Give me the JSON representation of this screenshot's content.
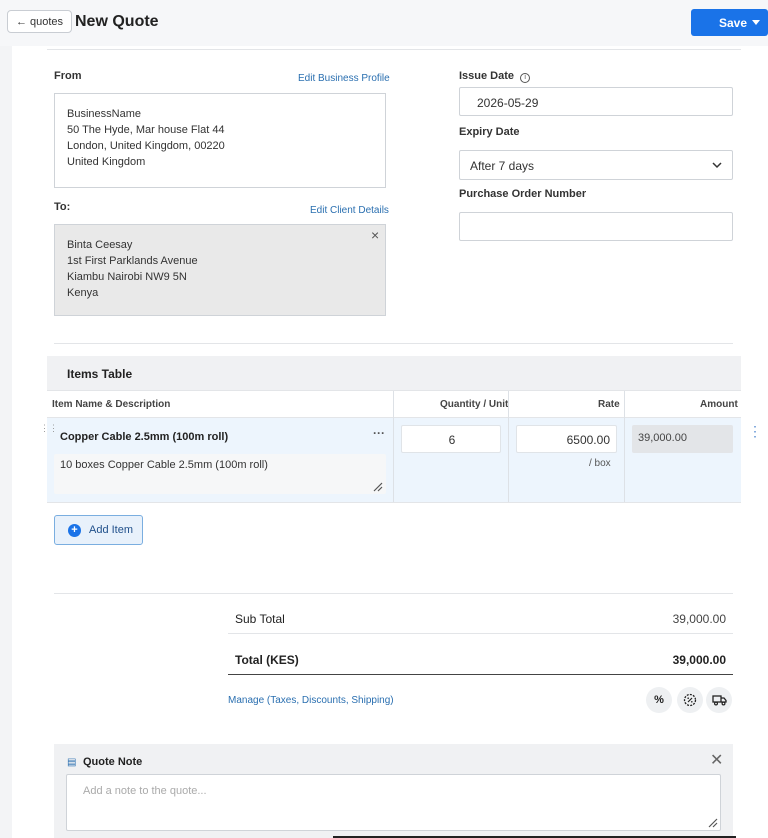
{
  "header": {
    "back_label": "quotes",
    "title": "New Quote",
    "save_label": "Save"
  },
  "from": {
    "label": "From",
    "edit_link": "Edit Business Profile",
    "lines": [
      "BusinessName",
      "50 The Hyde, Mar house Flat 44",
      "London, United Kingdom, 00220",
      "United Kingdom"
    ]
  },
  "to": {
    "label": "To:",
    "edit_link": "Edit Client Details",
    "lines": [
      "Binta Ceesay",
      "1st First Parklands Avenue",
      "Kiambu Nairobi NW9 5N",
      "Kenya"
    ]
  },
  "issue_date": {
    "label": "Issue Date",
    "value": "2026-05-29"
  },
  "expiry_date": {
    "label": "Expiry Date",
    "value": "After 7 days"
  },
  "po_number": {
    "label": "Purchase Order Number",
    "value": ""
  },
  "items_table": {
    "title": "Items Table",
    "columns": {
      "name": "Item Name & Description",
      "quantity": "Quantity / Unit",
      "rate": "Rate",
      "amount": "Amount"
    },
    "rows": [
      {
        "name": "Copper Cable 2.5mm (100m roll)",
        "description": "10  boxes Copper Cable 2.5mm (100m roll)",
        "quantity": "6",
        "rate": "6500.00",
        "unit": "/ box",
        "amount": "39,000.00"
      }
    ],
    "add_item_label": "Add Item"
  },
  "totals": {
    "subtotal_label": "Sub Total",
    "subtotal_value": "39,000.00",
    "total_label": "Total (KES)",
    "total_value": "39,000.00",
    "manage_link": "Manage (Taxes, Discounts, Shipping)"
  },
  "note": {
    "title": "Quote Note",
    "placeholder": "Add a note to the quote..."
  },
  "colors": {
    "accent": "#1a73e8",
    "link": "#2a6fb0",
    "row_highlight": "#edf5fd"
  }
}
